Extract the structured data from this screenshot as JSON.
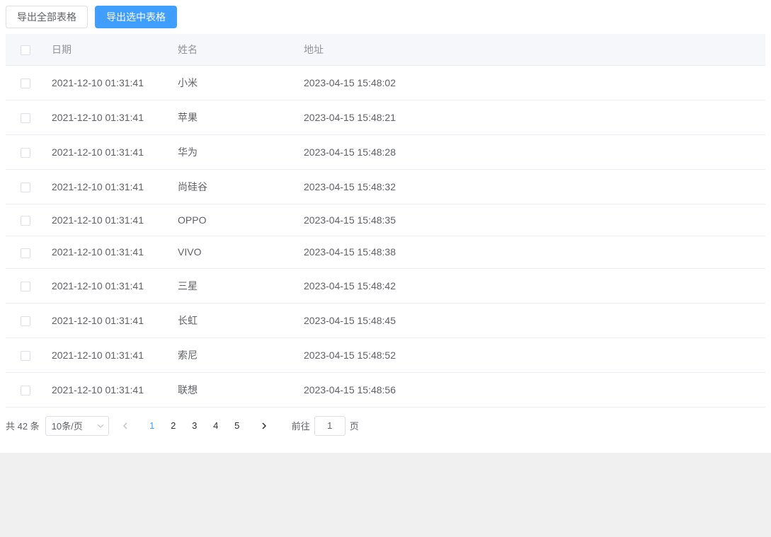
{
  "toolbar": {
    "export_all_label": "导出全部表格",
    "export_selected_label": "导出选中表格"
  },
  "table": {
    "headers": {
      "date": "日期",
      "name": "姓名",
      "address": "地址"
    },
    "rows": [
      {
        "date": "2021-12-10 01:31:41",
        "name": "小米",
        "address": "2023-04-15 15:48:02"
      },
      {
        "date": "2021-12-10 01:31:41",
        "name": "苹果",
        "address": "2023-04-15 15:48:21"
      },
      {
        "date": "2021-12-10 01:31:41",
        "name": "华为",
        "address": "2023-04-15 15:48:28"
      },
      {
        "date": "2021-12-10 01:31:41",
        "name": "尚硅谷",
        "address": "2023-04-15 15:48:32"
      },
      {
        "date": "2021-12-10 01:31:41",
        "name": "OPPO",
        "address": "2023-04-15 15:48:35"
      },
      {
        "date": "2021-12-10 01:31:41",
        "name": "VIVO",
        "address": "2023-04-15 15:48:38"
      },
      {
        "date": "2021-12-10 01:31:41",
        "name": "三星",
        "address": "2023-04-15 15:48:42"
      },
      {
        "date": "2021-12-10 01:31:41",
        "name": "长虹",
        "address": "2023-04-15 15:48:45"
      },
      {
        "date": "2021-12-10 01:31:41",
        "name": "索尼",
        "address": "2023-04-15 15:48:52"
      },
      {
        "date": "2021-12-10 01:31:41",
        "name": "联想",
        "address": "2023-04-15 15:48:56"
      }
    ]
  },
  "pagination": {
    "total_label": "共 42 条",
    "page_size_label": "10条/页",
    "pages": [
      "1",
      "2",
      "3",
      "4",
      "5"
    ],
    "current_page": "1",
    "jump_prefix": "前往",
    "jump_suffix": "页",
    "jump_value": "1"
  }
}
